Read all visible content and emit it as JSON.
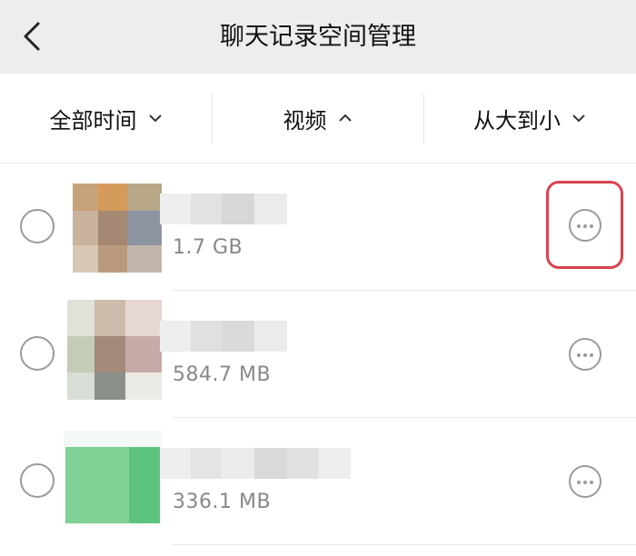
{
  "header": {
    "title": "聊天记录空间管理",
    "back_icon": "chevron-left-icon"
  },
  "filters": {
    "time": {
      "label": "全部时间",
      "icon": "chevron-down-icon"
    },
    "type": {
      "label": "视频",
      "icon": "chevron-up-icon"
    },
    "sort": {
      "label": "从大到小",
      "icon": "chevron-down-icon"
    }
  },
  "items": [
    {
      "size": "1.7 GB",
      "more_icon": "more-horizontal-icon",
      "highlighted": true
    },
    {
      "size": "584.7 MB",
      "more_icon": "more-horizontal-icon",
      "highlighted": false
    },
    {
      "size": "336.1 MB",
      "more_icon": "more-horizontal-icon",
      "highlighted": false
    }
  ],
  "colors": {
    "header_bg": "#ededed",
    "highlight_border": "#d9434f",
    "secondary_text": "#888888",
    "control_gray": "#9a9a9a"
  }
}
